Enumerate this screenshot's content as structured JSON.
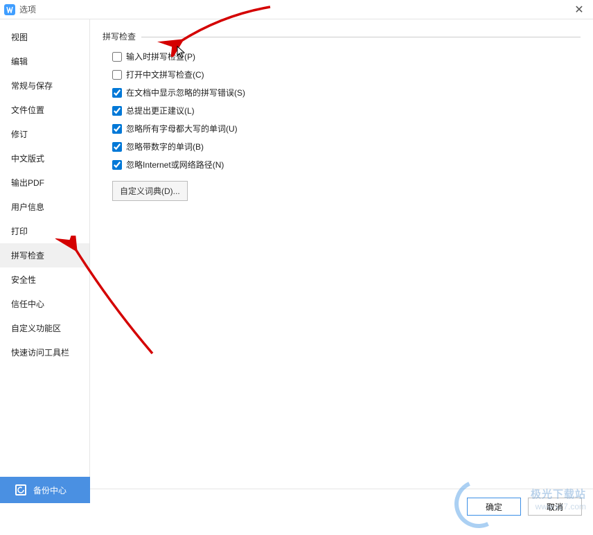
{
  "titlebar": {
    "title": "选项"
  },
  "sidebar": {
    "items": [
      {
        "label": "视图",
        "active": false
      },
      {
        "label": "编辑",
        "active": false
      },
      {
        "label": "常规与保存",
        "active": false
      },
      {
        "label": "文件位置",
        "active": false
      },
      {
        "label": "修订",
        "active": false
      },
      {
        "label": "中文版式",
        "active": false
      },
      {
        "label": "输出PDF",
        "active": false
      },
      {
        "label": "用户信息",
        "active": false
      },
      {
        "label": "打印",
        "active": false
      },
      {
        "label": "拼写检查",
        "active": true
      },
      {
        "label": "安全性",
        "active": false
      },
      {
        "label": "信任中心",
        "active": false
      },
      {
        "label": "自定义功能区",
        "active": false
      },
      {
        "label": "快速访问工具栏",
        "active": false
      }
    ]
  },
  "section": {
    "title": "拼写检查"
  },
  "options": [
    {
      "label": "输入时拼写检查(P)",
      "checked": false
    },
    {
      "label": "打开中文拼写检查(C)",
      "checked": false
    },
    {
      "label": "在文档中显示忽略的拼写错误(S)",
      "checked": true
    },
    {
      "label": "总提出更正建议(L)",
      "checked": true
    },
    {
      "label": "忽略所有字母都大写的单词(U)",
      "checked": true
    },
    {
      "label": "忽略带数字的单词(B)",
      "checked": true
    },
    {
      "label": "忽略Internet或网络路径(N)",
      "checked": true
    }
  ],
  "custom_dict_btn": "自定义词典(D)...",
  "backup_center": "备份中心",
  "actions": {
    "ok": "确定",
    "cancel": "取消"
  },
  "watermark": {
    "text": "极光下载站",
    "url": "www.xz7.com"
  }
}
